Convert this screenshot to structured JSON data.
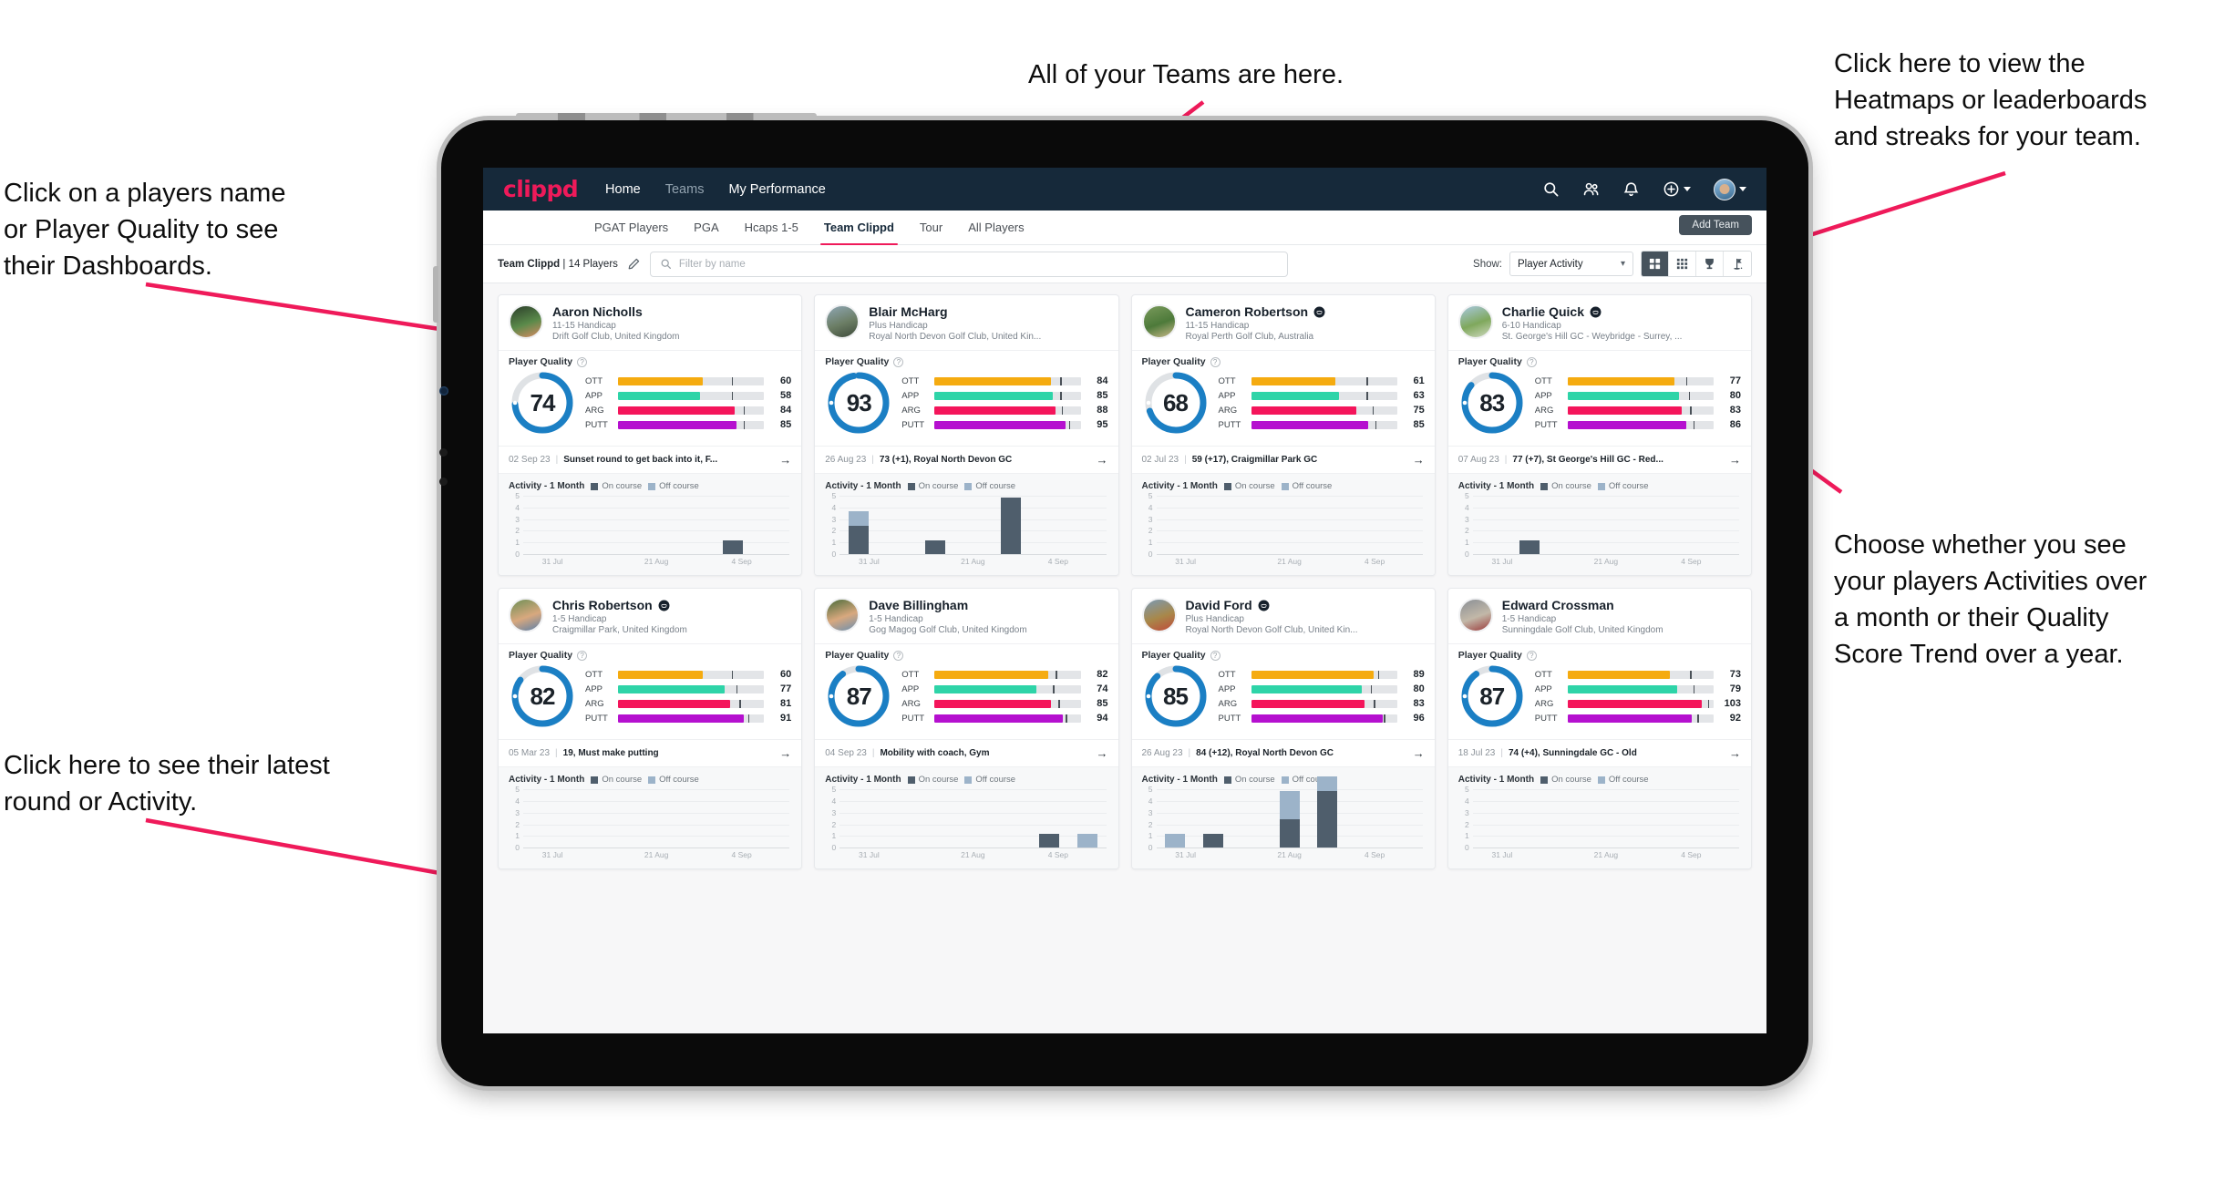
{
  "annotations": [
    {
      "id": "teams-note",
      "text": "All of your Teams are here."
    },
    {
      "id": "heatmaps-note",
      "text": "Click here to view the\nHeatmaps or leaderboards\nand streaks for your team."
    },
    {
      "id": "player-name-note",
      "text": "Click on a players name\nor Player Quality to see\ntheir Dashboards."
    },
    {
      "id": "activity-note",
      "text": "Choose whether you see\nyour players Activities over\na month or their Quality\nScore Trend over a year."
    },
    {
      "id": "latest-round-note",
      "text": "Click here to see their latest\nround or Activity."
    }
  ],
  "colors": {
    "accent_pink": "#ef1a5a",
    "navbar": "#16293a",
    "ring_blue": "#1b7fc4",
    "ott": "#f5ab10",
    "app": "#2ed4a8",
    "arg": "#f4155b",
    "putt": "#b510cf",
    "on_course": "#4f5e6c",
    "off_course": "#9cb3c9"
  },
  "navbar": {
    "brand": "clippd",
    "links": [
      {
        "label": "Home",
        "active": true
      },
      {
        "label": "Teams",
        "active": false
      },
      {
        "label": "My Performance",
        "active": true
      }
    ],
    "icons": [
      "search-icon",
      "people-icon",
      "bell-icon",
      "plus-circle-icon",
      "avatar"
    ]
  },
  "tabs": [
    {
      "label": "PGAT Players",
      "active": false
    },
    {
      "label": "PGA",
      "active": false
    },
    {
      "label": "Hcaps 1-5",
      "active": false
    },
    {
      "label": "Team Clippd",
      "active": true
    },
    {
      "label": "Tour",
      "active": false
    },
    {
      "label": "All Players",
      "active": false
    }
  ],
  "add_team_label": "Add Team",
  "filterbar": {
    "team_name": "Team Clippd",
    "team_separator": "|",
    "player_count": "14 Players",
    "edit_icon": "pencil-icon",
    "search_placeholder": "Filter by name",
    "show_label": "Show:",
    "show_value": "Player Activity",
    "show_options": [
      "Player Activity",
      "Quality Score Trend"
    ],
    "view_toggles": [
      {
        "icon": "grid-large-icon",
        "active": true
      },
      {
        "icon": "grid-small-icon",
        "active": false
      },
      {
        "icon": "trophy-icon",
        "active": false
      },
      {
        "icon": "flag-icon",
        "active": false
      }
    ]
  },
  "card_labels": {
    "player_quality": "Player Quality",
    "help": "?",
    "activity": "Activity - 1 Month",
    "on_course": "On course",
    "off_course": "Off course",
    "arrow": "→",
    "bar_labels": [
      "OTT",
      "APP",
      "ARG",
      "PUTT"
    ]
  },
  "chart_data": {
    "type": "bar",
    "title": "Activity - 1 Month",
    "stacked": true,
    "categories": [
      "31 Jul",
      "",
      "",
      "21 Aug",
      "",
      "4 Sep",
      ""
    ],
    "xticks": [
      "31 Jul",
      "21 Aug",
      "4 Sep"
    ],
    "yticks": [
      0,
      1,
      2,
      3,
      4,
      5
    ],
    "ylim": [
      0,
      5
    ],
    "legend": [
      "On course",
      "Off course"
    ],
    "legend_position": "top"
  },
  "players": [
    {
      "name": "Aaron Nicholls",
      "verified": false,
      "handicap": "11-15 Handicap",
      "club": "Drift Golf Club, United Kingdom",
      "avatar_colors": [
        "#2b3d2a",
        "#5a8a4a",
        "#d98b63"
      ],
      "quality": 74,
      "ring_pct": 74,
      "bars": [
        {
          "label": "OTT",
          "value": 60,
          "pct": 58,
          "tick": 78
        },
        {
          "label": "APP",
          "value": 58,
          "pct": 56,
          "tick": 78
        },
        {
          "label": "ARG",
          "value": 84,
          "pct": 80,
          "tick": 86
        },
        {
          "label": "PUTT",
          "value": 85,
          "pct": 81,
          "tick": 86
        }
      ],
      "round_date": "02 Sep 23",
      "round_text": "Sunset round to get back into it, F...",
      "activity": {
        "on": [
          0,
          0,
          0,
          0,
          0,
          1,
          0
        ],
        "off": [
          0,
          0,
          0,
          0,
          0,
          0,
          0
        ]
      }
    },
    {
      "name": "Blair McHarg",
      "verified": false,
      "handicap": "Plus Handicap",
      "club": "Royal North Devon Golf Club, United Kin...",
      "avatar_colors": [
        "#8fa7b5",
        "#6b7d64",
        "#3d4a3a"
      ],
      "quality": 93,
      "ring_pct": 97,
      "bars": [
        {
          "label": "OTT",
          "value": 84,
          "pct": 80,
          "tick": 86
        },
        {
          "label": "APP",
          "value": 85,
          "pct": 81,
          "tick": 86
        },
        {
          "label": "ARG",
          "value": 88,
          "pct": 83,
          "tick": 87
        },
        {
          "label": "PUTT",
          "value": 95,
          "pct": 90,
          "tick": 92
        }
      ],
      "round_date": "26 Aug 23",
      "round_text": "73 (+1), Royal North Devon GC",
      "activity": {
        "on": [
          2,
          0,
          1,
          0,
          4,
          0,
          0
        ],
        "off": [
          1,
          0,
          0,
          0,
          0,
          0,
          0
        ]
      }
    },
    {
      "name": "Cameron Robertson",
      "verified": true,
      "handicap": "11-15 Handicap",
      "club": "Royal Perth Golf Club, Australia",
      "avatar_colors": [
        "#7a9a5c",
        "#4d7a3a",
        "#c9b98a"
      ],
      "quality": 68,
      "ring_pct": 70,
      "bars": [
        {
          "label": "OTT",
          "value": 61,
          "pct": 58,
          "tick": 79
        },
        {
          "label": "APP",
          "value": 63,
          "pct": 60,
          "tick": 79
        },
        {
          "label": "ARG",
          "value": 75,
          "pct": 72,
          "tick": 83
        },
        {
          "label": "PUTT",
          "value": 85,
          "pct": 80,
          "tick": 85
        }
      ],
      "round_date": "02 Jul 23",
      "round_text": "59 (+17), Craigmillar Park GC",
      "activity": {
        "on": [
          0,
          0,
          0,
          0,
          0,
          0,
          0
        ],
        "off": [
          0,
          0,
          0,
          0,
          0,
          0,
          0
        ]
      }
    },
    {
      "name": "Charlie Quick",
      "verified": true,
      "handicap": "6-10 Handicap",
      "club": "St. George's Hill GC - Weybridge - Surrey, ...",
      "avatar_colors": [
        "#a8c8e0",
        "#7fa85c",
        "#cfd9c0"
      ],
      "quality": 83,
      "ring_pct": 86,
      "bars": [
        {
          "label": "OTT",
          "value": 77,
          "pct": 73,
          "tick": 81
        },
        {
          "label": "APP",
          "value": 80,
          "pct": 76,
          "tick": 83
        },
        {
          "label": "ARG",
          "value": 83,
          "pct": 78,
          "tick": 84
        },
        {
          "label": "PUTT",
          "value": 86,
          "pct": 81,
          "tick": 86
        }
      ],
      "round_date": "07 Aug 23",
      "round_text": "77 (+7), St George's Hill GC - Red...",
      "activity": {
        "on": [
          0,
          1,
          0,
          0,
          0,
          0,
          0
        ],
        "off": [
          0,
          0,
          0,
          0,
          0,
          0,
          0
        ]
      }
    },
    {
      "name": "Chris Robertson",
      "verified": true,
      "handicap": "1-5 Handicap",
      "club": "Craigmillar Park, United Kingdom",
      "avatar_colors": [
        "#6e8f56",
        "#d8a87e",
        "#5b7fa8"
      ],
      "quality": 82,
      "ring_pct": 85,
      "bars": [
        {
          "label": "OTT",
          "value": 60,
          "pct": 58,
          "tick": 78
        },
        {
          "label": "APP",
          "value": 77,
          "pct": 73,
          "tick": 81
        },
        {
          "label": "ARG",
          "value": 81,
          "pct": 77,
          "tick": 83
        },
        {
          "label": "PUTT",
          "value": 91,
          "pct": 86,
          "tick": 89
        }
      ],
      "round_date": "05 Mar 23",
      "round_text": "19, Must make putting",
      "activity": {
        "on": [
          0,
          0,
          0,
          0,
          0,
          0,
          0
        ],
        "off": [
          0,
          0,
          0,
          0,
          0,
          0,
          0
        ]
      }
    },
    {
      "name": "Dave Billingham",
      "verified": false,
      "handicap": "1-5 Handicap",
      "club": "Gog Magog Golf Club, United Kingdom",
      "avatar_colors": [
        "#4a6b3a",
        "#d8a87e",
        "#6b8fb0"
      ],
      "quality": 87,
      "ring_pct": 90,
      "bars": [
        {
          "label": "OTT",
          "value": 82,
          "pct": 78,
          "tick": 83
        },
        {
          "label": "APP",
          "value": 74,
          "pct": 70,
          "tick": 81
        },
        {
          "label": "ARG",
          "value": 85,
          "pct": 80,
          "tick": 85
        },
        {
          "label": "PUTT",
          "value": 94,
          "pct": 88,
          "tick": 90
        }
      ],
      "round_date": "04 Sep 23",
      "round_text": "Mobility with coach, Gym",
      "activity": {
        "on": [
          0,
          0,
          0,
          0,
          0,
          1,
          0
        ],
        "off": [
          0,
          0,
          0,
          0,
          0,
          0,
          1
        ]
      }
    },
    {
      "name": "David Ford",
      "verified": true,
      "handicap": "Plus Handicap",
      "club": "Royal North Devon Golf Club, United Kin...",
      "avatar_colors": [
        "#7a9ab5",
        "#a8884a",
        "#c04a3a"
      ],
      "quality": 85,
      "ring_pct": 88,
      "bars": [
        {
          "label": "OTT",
          "value": 89,
          "pct": 84,
          "tick": 87
        },
        {
          "label": "APP",
          "value": 80,
          "pct": 76,
          "tick": 82
        },
        {
          "label": "ARG",
          "value": 83,
          "pct": 78,
          "tick": 84
        },
        {
          "label": "PUTT",
          "value": 96,
          "pct": 90,
          "tick": 91
        }
      ],
      "round_date": "26 Aug 23",
      "round_text": "84 (+12), Royal North Devon GC",
      "activity": {
        "on": [
          0,
          1,
          0,
          2,
          4,
          0,
          0
        ],
        "off": [
          1,
          0,
          0,
          2,
          1,
          0,
          0
        ]
      }
    },
    {
      "name": "Edward Crossman",
      "verified": false,
      "handicap": "1-5 Handicap",
      "club": "Sunningdale Golf Club, United Kingdom",
      "avatar_colors": [
        "#8a8f95",
        "#c2b8a8",
        "#9a3a3a"
      ],
      "quality": 87,
      "ring_pct": 90,
      "bars": [
        {
          "label": "OTT",
          "value": 73,
          "pct": 70,
          "tick": 84
        },
        {
          "label": "APP",
          "value": 79,
          "pct": 75,
          "tick": 86
        },
        {
          "label": "ARG",
          "value": 103,
          "pct": 92,
          "tick": 96
        },
        {
          "label": "PUTT",
          "value": 92,
          "pct": 85,
          "tick": 89
        }
      ],
      "round_date": "18 Jul 23",
      "round_text": "74 (+4), Sunningdale GC - Old",
      "activity": {
        "on": [
          0,
          0,
          0,
          0,
          0,
          0,
          0
        ],
        "off": [
          0,
          0,
          0,
          0,
          0,
          0,
          0
        ]
      }
    }
  ]
}
